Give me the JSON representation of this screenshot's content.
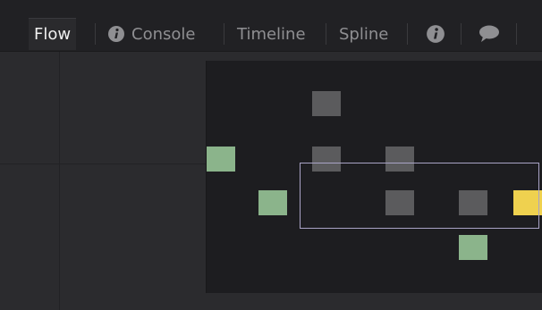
{
  "tabs": [
    {
      "label": "Flow",
      "icon": null,
      "active": true
    },
    {
      "label": "Console",
      "icon": "info-icon",
      "active": false
    },
    {
      "label": "Timeline",
      "icon": null,
      "active": false
    },
    {
      "label": "Spline",
      "icon": null,
      "active": false
    },
    {
      "label": "",
      "icon": "info-icon",
      "active": false
    },
    {
      "label": "",
      "icon": "speech-bubble-icon",
      "active": false
    }
  ],
  "colors": {
    "node_gray": "#5b5b5d",
    "node_green": "#8bb48b",
    "node_yellow": "#efd14f",
    "viewport_outline": "#a9a3c6"
  }
}
